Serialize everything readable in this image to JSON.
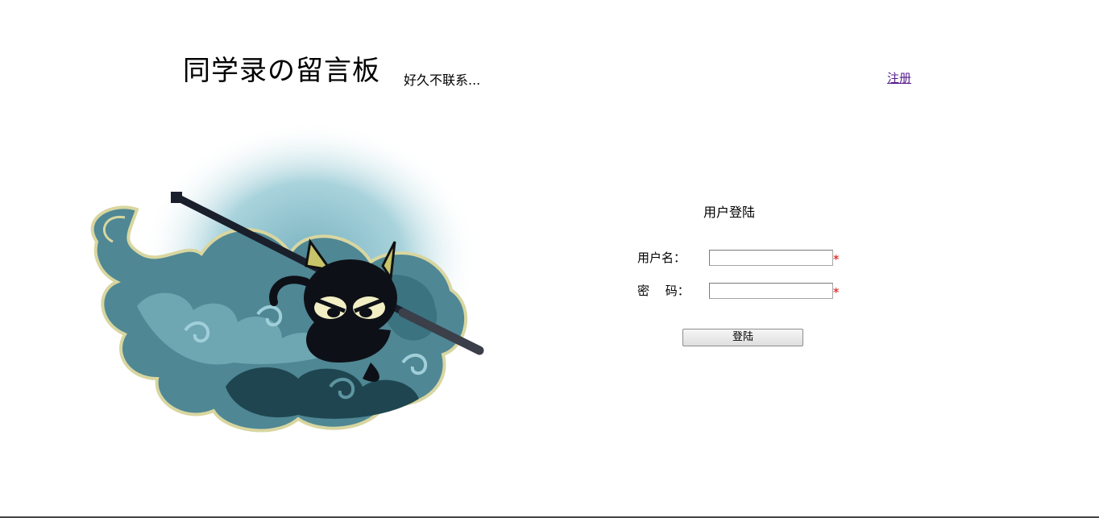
{
  "header": {
    "title": "同学录の留言板",
    "subtitle": "好久不联系...",
    "register_link": "注册"
  },
  "hero": {
    "image": "ninja-cat-on-cloud"
  },
  "login": {
    "title": "用户登陆",
    "username_label": "用户名：",
    "username_value": "",
    "password_label": "密　 码：",
    "password_value": "",
    "required_mark": "*",
    "submit_label": "登陆"
  },
  "colors": {
    "link": "#551a8b",
    "required": "#e00000",
    "cloud_light": "#6fa7b3",
    "cloud_dark": "#2d5a66",
    "glow": "#b9dde4"
  }
}
